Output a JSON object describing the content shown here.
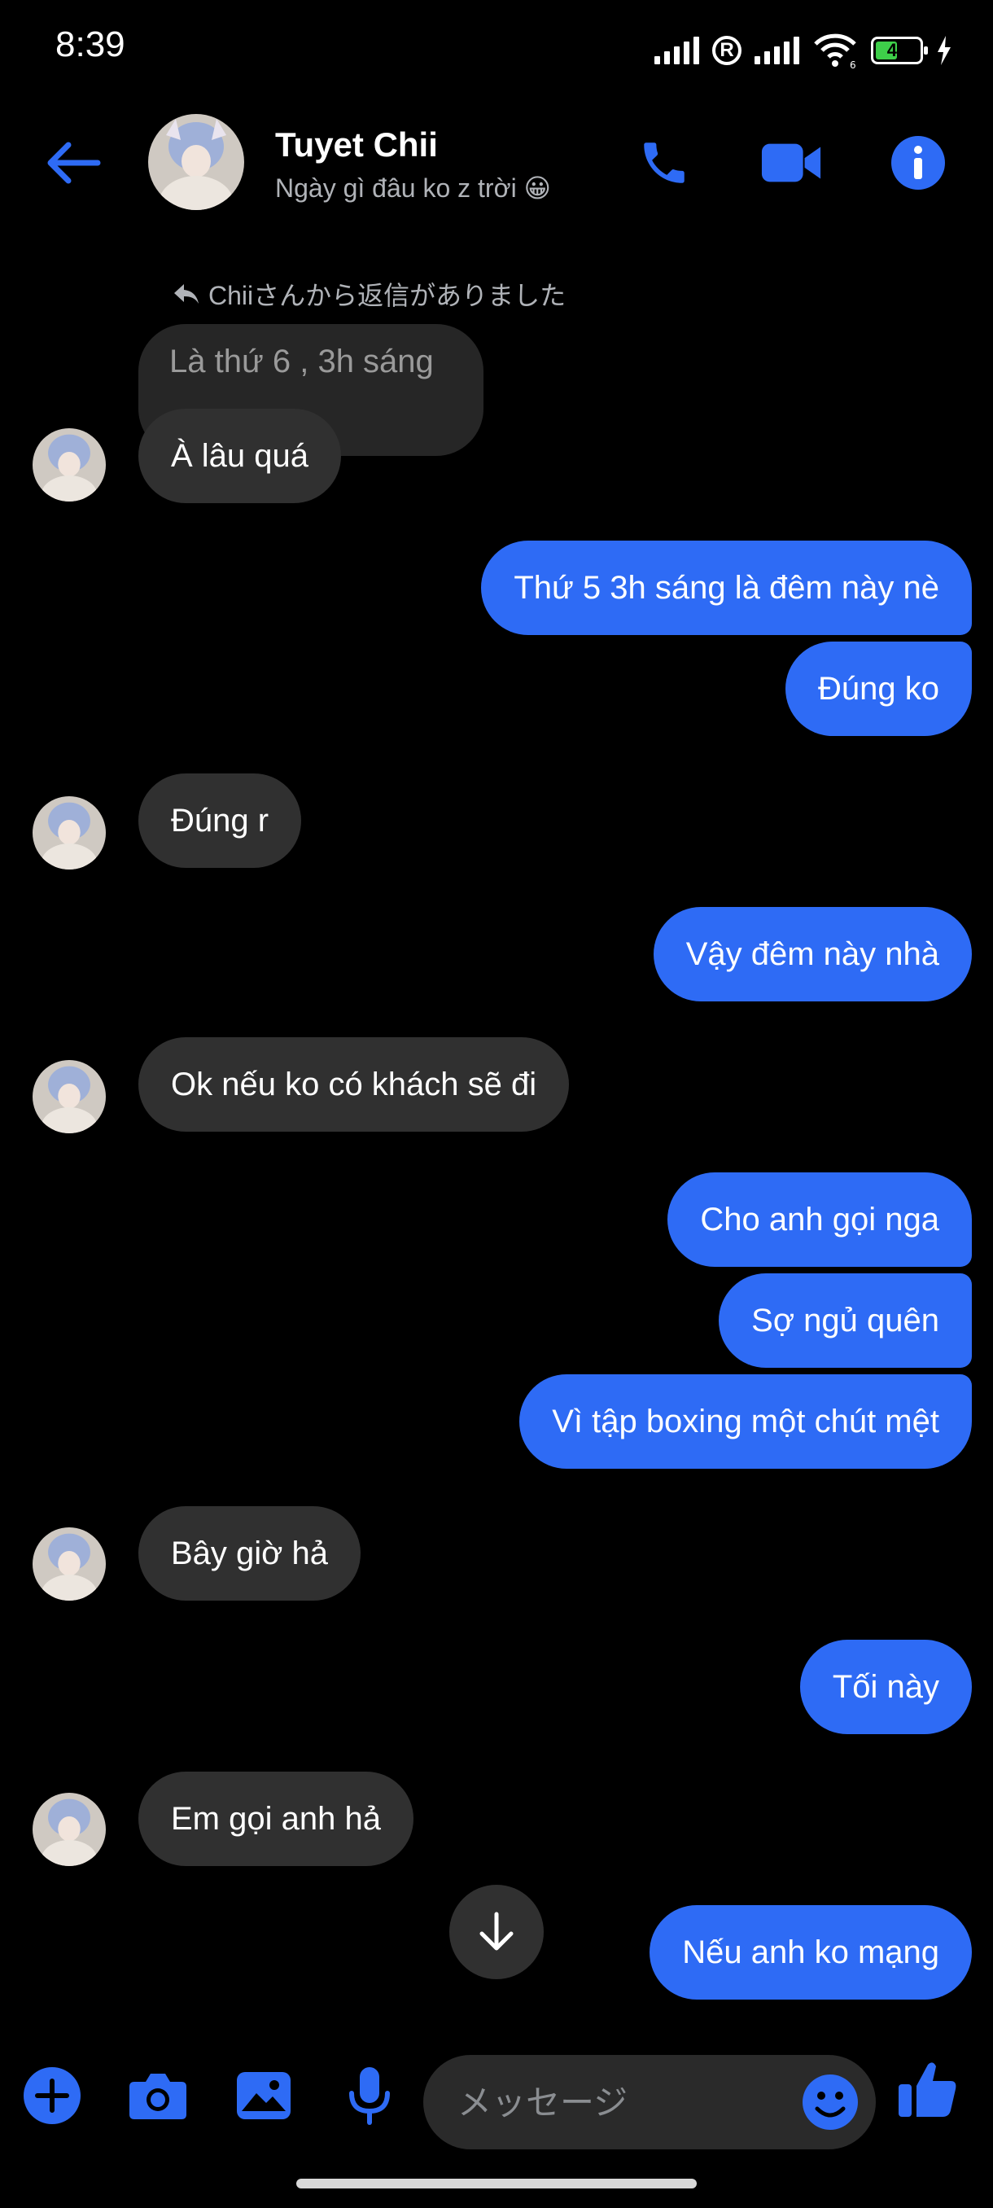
{
  "status_bar": {
    "time": "8:39",
    "battery": "45"
  },
  "header": {
    "contact_name": "Tuyet Chii",
    "contact_status": "Ngày gì đâu ko z trời 😀"
  },
  "reply_context": {
    "note": "Chiiさんから返信がありました",
    "quoted_text": "Là thứ 6 , 3h sáng"
  },
  "messages": [
    {
      "from": "them",
      "text": "À lâu quá"
    },
    {
      "from": "me",
      "text": "Thứ 5 3h sáng là đêm này nè"
    },
    {
      "from": "me",
      "text": "Đúng ko"
    },
    {
      "from": "them",
      "text": "Đúng r"
    },
    {
      "from": "me",
      "text": "Vậy đêm này nhà"
    },
    {
      "from": "them",
      "text": "Ok nếu ko có khách sẽ đi"
    },
    {
      "from": "me",
      "text": "Cho anh gọi nga"
    },
    {
      "from": "me",
      "text": "Sợ ngủ quên"
    },
    {
      "from": "me",
      "text": "Vì tập boxing một chút mệt"
    },
    {
      "from": "them",
      "text": "Bây giờ hả"
    },
    {
      "from": "me",
      "text": "Tối này"
    },
    {
      "from": "them",
      "text": "Em gọi anh hả"
    },
    {
      "from": "me",
      "text": "Nếu anh  ko mạng"
    }
  ],
  "composer": {
    "placeholder": "メッセージ"
  },
  "colors": {
    "accent": "#2e6bf5",
    "incoming_bubble": "#303030",
    "background": "#000000"
  }
}
